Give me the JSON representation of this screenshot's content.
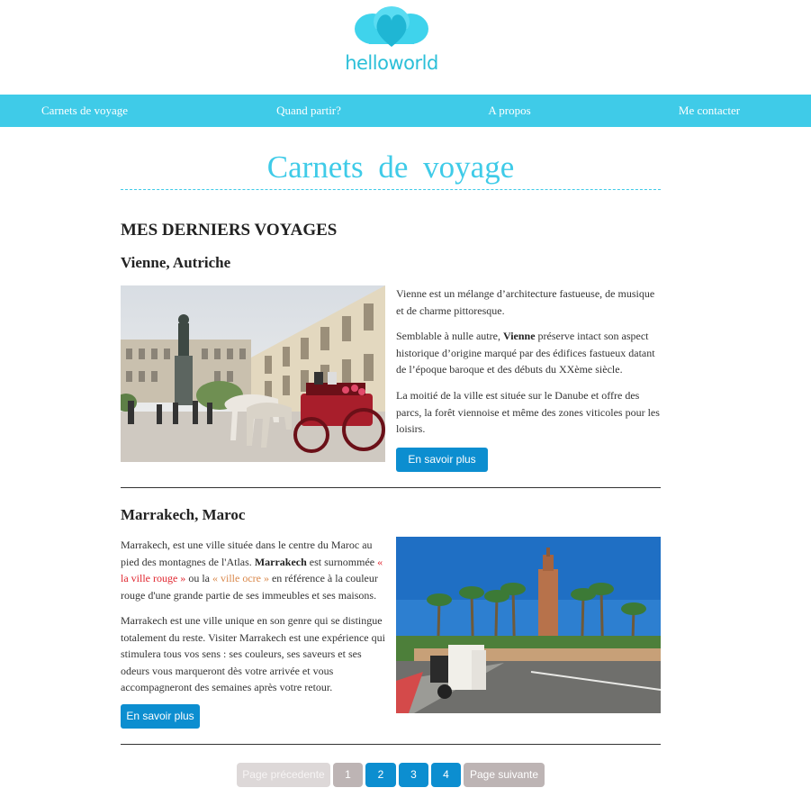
{
  "brand": {
    "logo_text": "helloworld"
  },
  "nav": {
    "items": [
      {
        "label": "Carnets de voyage"
      },
      {
        "label": "Quand partir?"
      },
      {
        "label": "A propos"
      },
      {
        "label": "Me contacter"
      }
    ]
  },
  "page": {
    "title": "Carnets de voyage",
    "section_heading": "MES DERNIERS VOYAGES"
  },
  "articles": [
    {
      "title": "Vienne, Autriche",
      "p1": "Vienne est un mélange d’architecture fastueuse, de musique et de charme pittoresque.",
      "p2_before": "Semblable à nulle autre, ",
      "p2_bold": "Vienne",
      "p2_after": " préserve intact son aspect historique d’origine marqué par des édifices fastueux datant de l’époque baroque et des débuts du XXème siècle.",
      "p3": "La moitié de la ville est située sur le Danube et offre des parcs, la forêt viennoise et même des zones viticoles pour les loisirs.",
      "button": "En savoir plus"
    },
    {
      "title": "Marrakech, Maroc",
      "p1_a": "Marrakech, est une ville située dans le centre du Maroc au pied des montagnes de l'Atlas. ",
      "p1_bold": "Marrakech",
      "p1_b": " est surnommée ",
      "p1_red": "« la ville rouge »",
      "p1_c": " ou la ",
      "p1_ocre": "« ville ocre »",
      "p1_d": " en référence à la couleur rouge d'une grande partie de ses immeubles et ses maisons.",
      "p2": "Marrakech est une ville unique en son genre qui se distingue totalement du reste. Visiter Marrakech est une expérience qui stimulera tous vos sens : ses couleurs, ses saveurs et ses odeurs vous marqueront dès votre arrivée et vous accompagneront des semaines après votre retour.",
      "button": "En savoir plus"
    }
  ],
  "pagination": {
    "prev": "Page précedente",
    "pages": [
      "1",
      "2",
      "3",
      "4"
    ],
    "next": "Page suivante"
  },
  "colors": {
    "accent": "#3fcbe8",
    "button": "#0c8ed0",
    "text": "#333333"
  }
}
